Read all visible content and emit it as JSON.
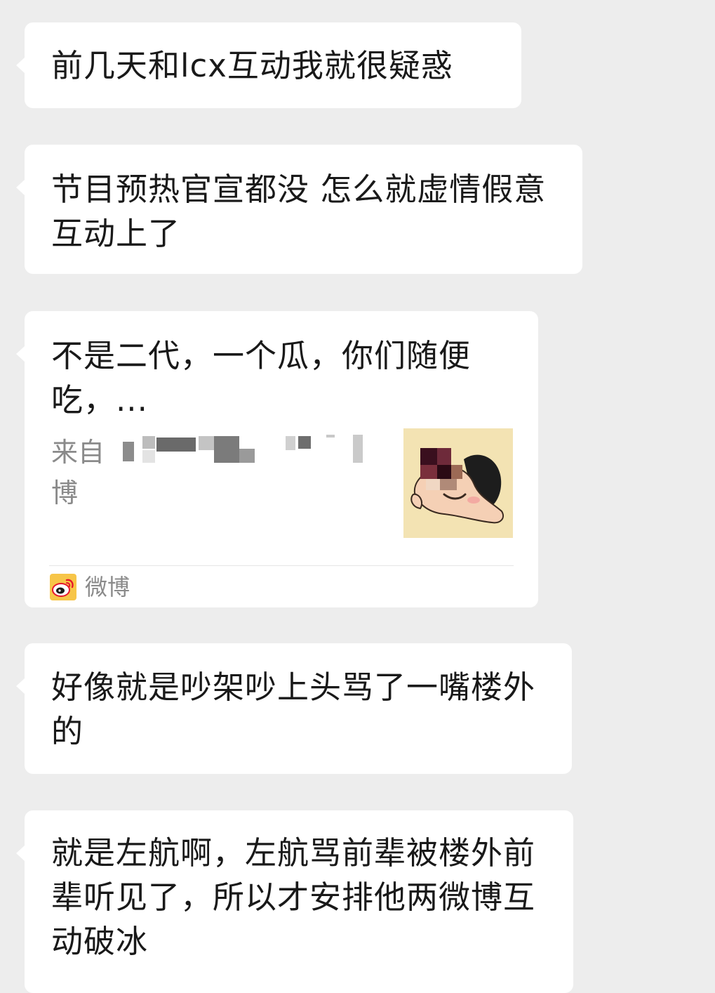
{
  "messages": [
    {
      "text": "前几天和lcx互动我就很疑惑"
    },
    {
      "text": "节目预热官宣都没 怎么就虚情假意互动上了"
    },
    {
      "card": {
        "title": "不是二代，一个瓜，你们随便吃，...",
        "source_line1": "来自",
        "source_line2": "博",
        "thumbnail_icon": "cartoon-face-thumbnail",
        "app_name": "微博",
        "app_icon": "weibo-logo-icon"
      }
    },
    {
      "text": "好像就是吵架吵上头骂了一嘴楼外的"
    },
    {
      "text": "就是左航啊，左航骂前辈被楼外前辈听见了，所以才安排他两微博互动破冰"
    }
  ],
  "colors": {
    "background": "#ededed",
    "bubble": "#ffffff",
    "text": "#191919",
    "secondary_text": "#8a8a8a"
  }
}
